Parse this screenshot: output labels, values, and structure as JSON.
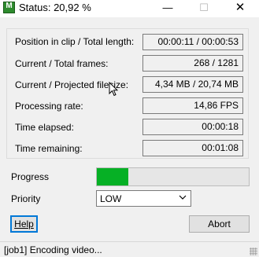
{
  "window": {
    "title": "Status: 20,92 %",
    "icon_glyph": "M",
    "minimize_glyph": "—",
    "maximize_glyph": "☐",
    "close_glyph": "✕"
  },
  "stats": [
    {
      "label": "Position in clip / Total length:",
      "value": "00:00:11 / 00:00:53"
    },
    {
      "label": "Current / Total frames:",
      "value": "268 / 1281"
    },
    {
      "label": "Current / Projected filesize:",
      "value": "4,34 MB / 20,74 MB"
    },
    {
      "label": "Processing rate:",
      "value": "14,86 FPS"
    },
    {
      "label": "Time elapsed:",
      "value": "00:00:18"
    },
    {
      "label": "Time remaining:",
      "value": "00:01:08"
    }
  ],
  "progress": {
    "label": "Progress",
    "fraction": 0.2092,
    "color": "#06b025"
  },
  "priority": {
    "label": "Priority",
    "value": "LOW"
  },
  "buttons": {
    "help": "Help",
    "abort": "Abort"
  },
  "status_bar": {
    "text": "[job1]  Encoding video..."
  }
}
